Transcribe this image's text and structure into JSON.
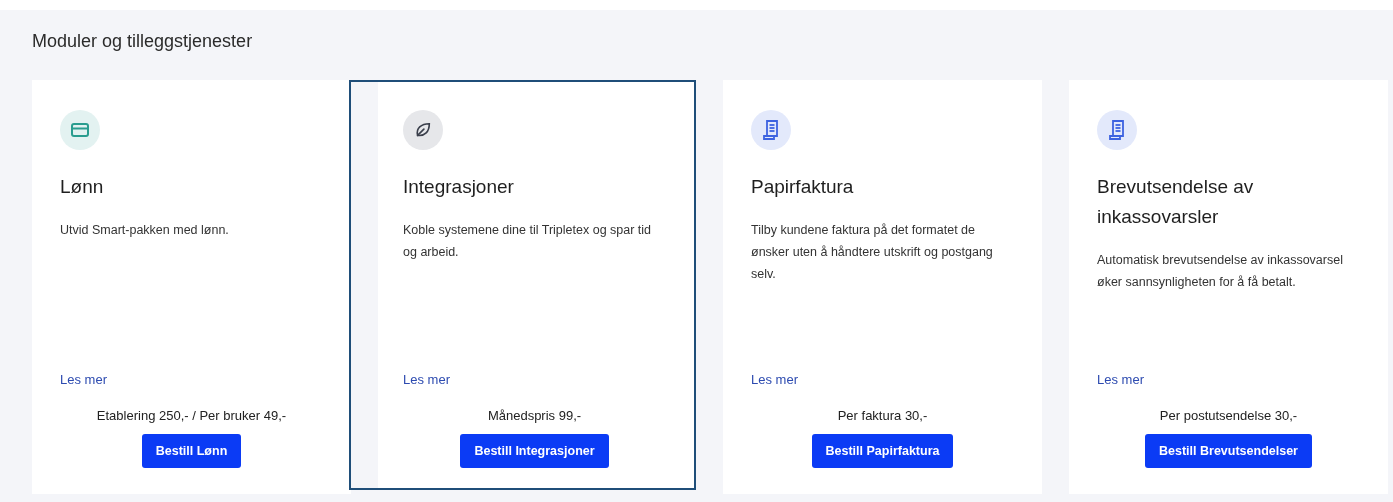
{
  "title": "Moduler og tilleggstjenester",
  "cards": [
    {
      "kind": "card",
      "selected": false,
      "heading": "Lønn",
      "description": "Utvid Smart-pakken med lønn.",
      "link": "Les mer",
      "price": "Etablering 250,- / Per bruker 49,-",
      "button": "Bestill Lønn"
    },
    {
      "kind": "leaf",
      "selected": true,
      "heading": "Integrasjoner",
      "description": "Koble systemene dine til Tripletex og spar tid og arbeid.",
      "link": "Les mer",
      "price": "Månedspris 99,-",
      "button": "Bestill Integrasjoner"
    },
    {
      "kind": "receipt",
      "selected": false,
      "heading": "Papirfaktura",
      "description": "Tilby kundene faktura på det formatet de ønsker uten å håndtere utskrift og postgang selv.",
      "link": "Les mer",
      "price": "Per faktura 30,-",
      "button": "Bestill Papirfaktura"
    },
    {
      "kind": "receipt",
      "selected": false,
      "heading": "Brevutsendelse av inkassovarsler",
      "description": "Automatisk brevutsendelse av inkassovarsel øker sannsynligheten for å få betalt.",
      "link": "Les mer",
      "price": "Per postutsendelse 30,-",
      "button": "Bestill Brevutsendelser"
    }
  ]
}
